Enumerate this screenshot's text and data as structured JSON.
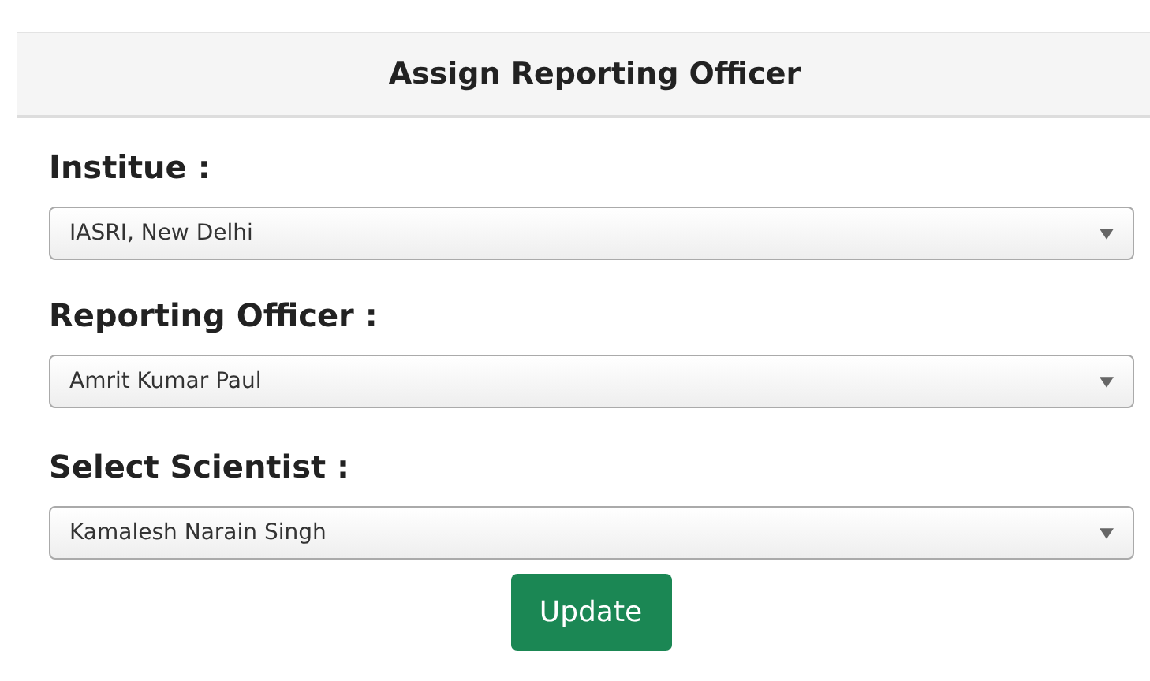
{
  "panel": {
    "title": "Assign Reporting Officer"
  },
  "fields": [
    {
      "label": "Institue :",
      "value": "IASRI, New Delhi"
    },
    {
      "label": "Reporting Officer :",
      "value": "Amrit Kumar Paul"
    },
    {
      "label": "Select Scientist :",
      "value": "Kamalesh Narain Singh"
    }
  ],
  "buttons": [
    "Update"
  ]
}
